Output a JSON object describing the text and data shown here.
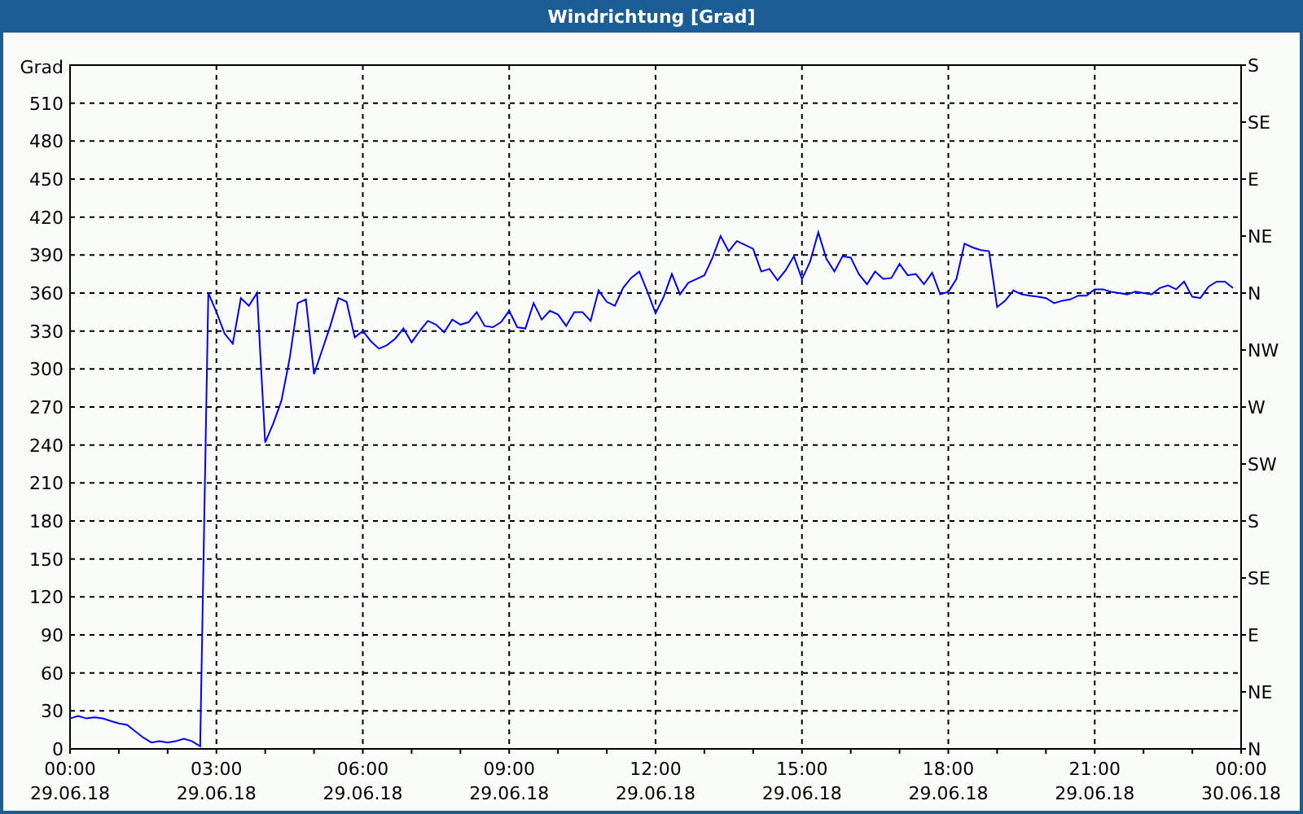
{
  "window": {
    "title": "Windrichtung [Grad]"
  },
  "chart": {
    "compass_labels": [
      "S",
      "SE",
      "E",
      "NE",
      "N",
      "NW",
      "W",
      "SW",
      "S",
      "SE",
      "E",
      "NE",
      "N"
    ],
    "dates": [
      "29.06.18",
      "29.06.18",
      "29.06.18",
      "29.06.18",
      "29.06.18",
      "29.06.18",
      "29.06.18",
      "29.06.18",
      "30.06.18"
    ],
    "chart_data": {
      "type": "line",
      "grid": true,
      "ylabel": "Grad",
      "ylim": [
        0,
        540
      ],
      "yticks": [
        0,
        30,
        60,
        90,
        120,
        150,
        180,
        210,
        240,
        270,
        300,
        330,
        360,
        390,
        420,
        450,
        480,
        510
      ],
      "categories": [
        "00:00",
        null,
        null,
        null,
        null,
        null,
        null,
        null,
        null,
        null,
        null,
        null,
        null,
        null,
        null,
        null,
        null,
        null,
        "03:00",
        null,
        null,
        null,
        null,
        null,
        null,
        null,
        null,
        null,
        null,
        null,
        null,
        null,
        null,
        null,
        null,
        null,
        "06:00",
        null,
        null,
        null,
        null,
        null,
        null,
        null,
        null,
        null,
        null,
        null,
        null,
        null,
        null,
        null,
        null,
        null,
        "09:00",
        null,
        null,
        null,
        null,
        null,
        null,
        null,
        null,
        null,
        null,
        null,
        null,
        null,
        null,
        null,
        null,
        null,
        "12:00",
        null,
        null,
        null,
        null,
        null,
        null,
        null,
        null,
        null,
        null,
        null,
        null,
        null,
        null,
        null,
        null,
        null,
        "15:00",
        null,
        null,
        null,
        null,
        null,
        null,
        null,
        null,
        null,
        null,
        null,
        null,
        null,
        null,
        null,
        null,
        null,
        "18:00",
        null,
        null,
        null,
        null,
        null,
        null,
        null,
        null,
        null,
        null,
        null,
        null,
        null,
        null,
        null,
        null,
        null,
        "21:00",
        null,
        null,
        null,
        null,
        null,
        null,
        null,
        null,
        null,
        null,
        null,
        null,
        null,
        null,
        null,
        null,
        null,
        "00:00"
      ],
      "series": [
        {
          "color": "#0000ff",
          "values": [
            24,
            26,
            24,
            25,
            24,
            22,
            20,
            19,
            14,
            9,
            5,
            6,
            5,
            6,
            8,
            6,
            2,
            360,
            345,
            328,
            320,
            356,
            350,
            360,
            242,
            257,
            275,
            308,
            352,
            355,
            296,
            315,
            334,
            356,
            353,
            325,
            330,
            322,
            316,
            319,
            324,
            332,
            321,
            330,
            338,
            335,
            329,
            339,
            335,
            337,
            345,
            334,
            333,
            337,
            346,
            333,
            332,
            352,
            339,
            346,
            343,
            334,
            345,
            345,
            338,
            362,
            353,
            350,
            364,
            372,
            377,
            361,
            344,
            357,
            375,
            359,
            368,
            371,
            374,
            388,
            405,
            393,
            401,
            398,
            395,
            377,
            379,
            370,
            378,
            389,
            371,
            385,
            408,
            387,
            377,
            389,
            388,
            375,
            367,
            377,
            371,
            372,
            383,
            374,
            375,
            367,
            376,
            359,
            361,
            371,
            399,
            396,
            394,
            393,
            349,
            354,
            362,
            359,
            358,
            357,
            356,
            352,
            354,
            355,
            358,
            358,
            363,
            363,
            361,
            360,
            359,
            361,
            360,
            359,
            364,
            366,
            363,
            369,
            357,
            356,
            365,
            369,
            369,
            364,
            null
          ]
        }
      ]
    }
  }
}
